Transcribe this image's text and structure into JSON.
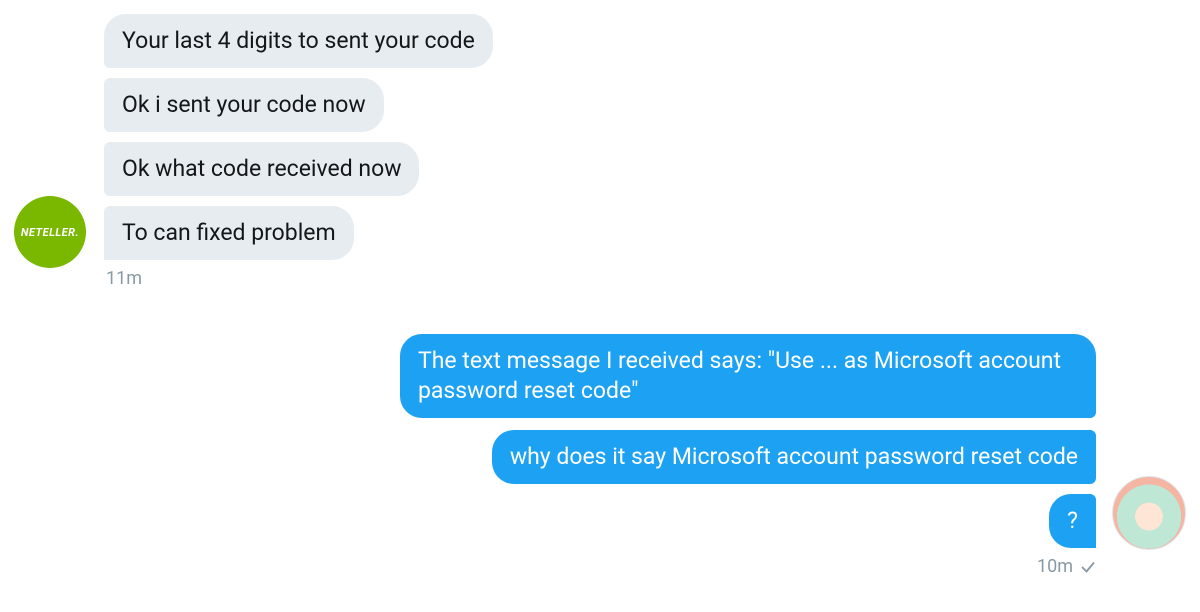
{
  "received": {
    "avatar_label": "NETELLER.",
    "messages": [
      "Your last 4 digits to sent your code",
      "Ok i sent your code now",
      "Ok what code received now",
      "To can fixed problem"
    ],
    "timestamp": "11m"
  },
  "sent": {
    "messages": [
      "The text message I received says: \"Use ... as Microsoft account password reset code\"",
      "why does it say Microsoft account password reset code",
      "?"
    ],
    "timestamp": "10m"
  },
  "colors": {
    "received_bubble": "#e6ecf0",
    "sent_bubble": "#1da1f2",
    "timestamp": "#8899a6",
    "avatar_left_bg": "#7ab800"
  }
}
